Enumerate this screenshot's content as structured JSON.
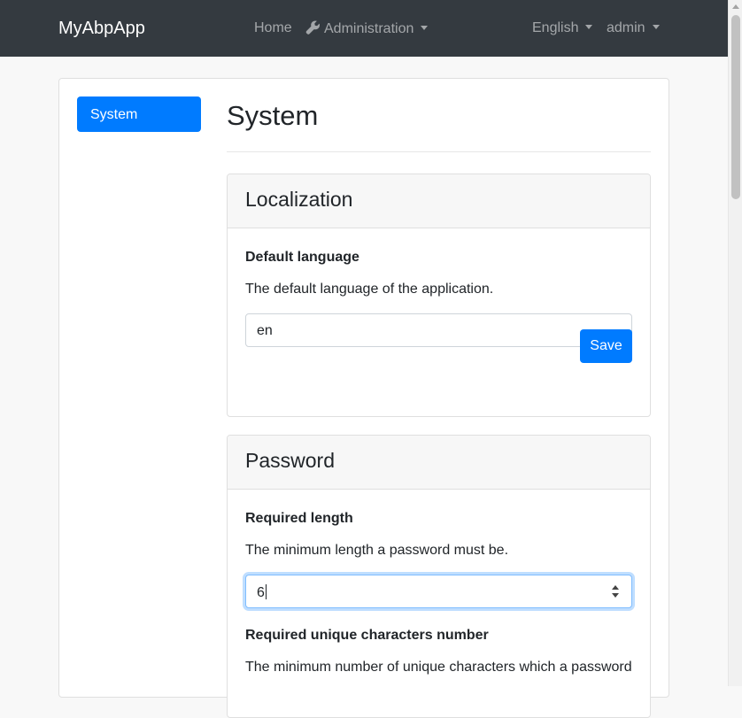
{
  "navbar": {
    "brand": "MyAbpApp",
    "home": "Home",
    "administration": "Administration",
    "language": "English",
    "user": "admin"
  },
  "sidebar": {
    "items": [
      {
        "label": "System"
      }
    ]
  },
  "page": {
    "title": "System"
  },
  "localization": {
    "header": "Localization",
    "default_language_label": "Default language",
    "default_language_help": "The default language of the application.",
    "default_language_value": "en",
    "save_label": "Save"
  },
  "password": {
    "header": "Password",
    "required_length_label": "Required length",
    "required_length_help": "The minimum length a password must be.",
    "required_length_value": "6",
    "unique_chars_label": "Required unique characters number",
    "unique_chars_help": "The minimum number of unique characters which a password"
  },
  "icons": {
    "administration": "wrench-icon"
  },
  "colors": {
    "navbar": "#343a40",
    "primary": "#007bff"
  }
}
